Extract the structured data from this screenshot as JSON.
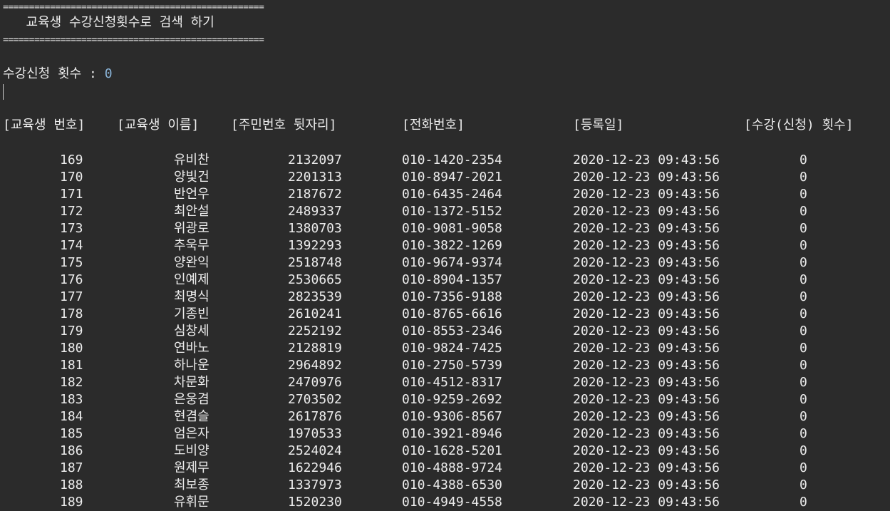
{
  "separator": "==================================================",
  "title": "   교육생 수강신청횟수로 검색 하기",
  "prompt": {
    "label": "수강신청 횟수 : ",
    "value": "0"
  },
  "headers": {
    "no": "[교육생 번호]",
    "name": "[교육생 이름]",
    "ssn": "[주민번호 뒷자리]",
    "tel": "[전화번호]",
    "date": "[등록일]",
    "count": "[수강(신청) 횟수]"
  },
  "rows": [
    {
      "no": "169",
      "name": "유비찬",
      "ssn": "2132097",
      "tel": "010-1420-2354",
      "date": "2020-12-23 09:43:56",
      "count": "0"
    },
    {
      "no": "170",
      "name": "양빛건",
      "ssn": "2201313",
      "tel": "010-8947-2021",
      "date": "2020-12-23 09:43:56",
      "count": "0"
    },
    {
      "no": "171",
      "name": "반언우",
      "ssn": "2187672",
      "tel": "010-6435-2464",
      "date": "2020-12-23 09:43:56",
      "count": "0"
    },
    {
      "no": "172",
      "name": "최안설",
      "ssn": "2489337",
      "tel": "010-1372-5152",
      "date": "2020-12-23 09:43:56",
      "count": "0"
    },
    {
      "no": "173",
      "name": "위광로",
      "ssn": "1380703",
      "tel": "010-9081-9058",
      "date": "2020-12-23 09:43:56",
      "count": "0"
    },
    {
      "no": "174",
      "name": "추욱무",
      "ssn": "1392293",
      "tel": "010-3822-1269",
      "date": "2020-12-23 09:43:56",
      "count": "0"
    },
    {
      "no": "175",
      "name": "양완익",
      "ssn": "2518748",
      "tel": "010-9674-9374",
      "date": "2020-12-23 09:43:56",
      "count": "0"
    },
    {
      "no": "176",
      "name": "인예제",
      "ssn": "2530665",
      "tel": "010-8904-1357",
      "date": "2020-12-23 09:43:56",
      "count": "0"
    },
    {
      "no": "177",
      "name": "최명식",
      "ssn": "2823539",
      "tel": "010-7356-9188",
      "date": "2020-12-23 09:43:56",
      "count": "0"
    },
    {
      "no": "178",
      "name": "기종빈",
      "ssn": "2610241",
      "tel": "010-8765-6616",
      "date": "2020-12-23 09:43:56",
      "count": "0"
    },
    {
      "no": "179",
      "name": "심창세",
      "ssn": "2252192",
      "tel": "010-8553-2346",
      "date": "2020-12-23 09:43:56",
      "count": "0"
    },
    {
      "no": "180",
      "name": "연바노",
      "ssn": "2128819",
      "tel": "010-9824-7425",
      "date": "2020-12-23 09:43:56",
      "count": "0"
    },
    {
      "no": "181",
      "name": "하나운",
      "ssn": "2964892",
      "tel": "010-2750-5739",
      "date": "2020-12-23 09:43:56",
      "count": "0"
    },
    {
      "no": "182",
      "name": "차문화",
      "ssn": "2470976",
      "tel": "010-4512-8317",
      "date": "2020-12-23 09:43:56",
      "count": "0"
    },
    {
      "no": "183",
      "name": "은웅겸",
      "ssn": "2703502",
      "tel": "010-9259-2692",
      "date": "2020-12-23 09:43:56",
      "count": "0"
    },
    {
      "no": "184",
      "name": "현겸슬",
      "ssn": "2617876",
      "tel": "010-9306-8567",
      "date": "2020-12-23 09:43:56",
      "count": "0"
    },
    {
      "no": "185",
      "name": "엄은자",
      "ssn": "1970533",
      "tel": "010-3921-8946",
      "date": "2020-12-23 09:43:56",
      "count": "0"
    },
    {
      "no": "186",
      "name": "도비양",
      "ssn": "2524024",
      "tel": "010-1628-5201",
      "date": "2020-12-23 09:43:56",
      "count": "0"
    },
    {
      "no": "187",
      "name": "원제무",
      "ssn": "1622946",
      "tel": "010-4888-9724",
      "date": "2020-12-23 09:43:56",
      "count": "0"
    },
    {
      "no": "188",
      "name": "최보종",
      "ssn": "1337973",
      "tel": "010-4388-6530",
      "date": "2020-12-23 09:43:56",
      "count": "0"
    },
    {
      "no": "189",
      "name": "유휘문",
      "ssn": "1520230",
      "tel": "010-4949-4558",
      "date": "2020-12-23 09:43:56",
      "count": "0"
    }
  ]
}
